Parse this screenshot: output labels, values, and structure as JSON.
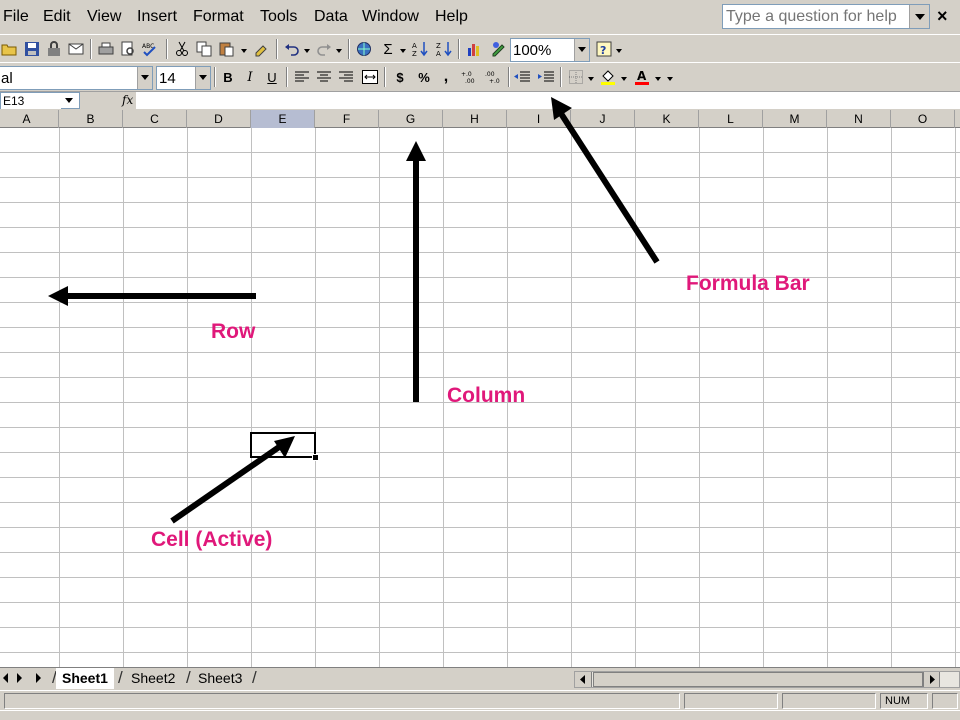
{
  "menubar": {
    "items": [
      {
        "id": "file",
        "label": "File"
      },
      {
        "id": "edit",
        "label": "Edit"
      },
      {
        "id": "view",
        "label": "View"
      },
      {
        "id": "insert",
        "label": "Insert"
      },
      {
        "id": "format",
        "label": "Format"
      },
      {
        "id": "tools",
        "label": "Tools"
      },
      {
        "id": "data",
        "label": "Data"
      },
      {
        "id": "window",
        "label": "Window"
      },
      {
        "id": "help",
        "label": "Help"
      }
    ],
    "help_placeholder": "Type a question for help"
  },
  "standard_toolbar": {
    "zoom": "100%"
  },
  "format_toolbar": {
    "font_name": "al",
    "font_size": "14",
    "bold": "B",
    "italic": "I",
    "underline": "U",
    "currency": "$",
    "percent": "%",
    "comma": ","
  },
  "formula_bar": {
    "name_box": "E13",
    "fx": "fx",
    "formula": ""
  },
  "grid": {
    "columns": [
      "A",
      "B",
      "C",
      "D",
      "E",
      "F",
      "G",
      "H",
      "I",
      "J",
      "K",
      "L",
      "M",
      "N",
      "O"
    ],
    "active_column": "E"
  },
  "annotations": {
    "row": "Row",
    "column": "Column",
    "formula_bar": "Formula Bar",
    "active_cell": "Cell (Active)",
    "color": "#e0187a"
  },
  "sheets": {
    "tabs": [
      "Sheet1",
      "Sheet2",
      "Sheet3"
    ],
    "active": "Sheet1"
  },
  "status_bar": {
    "num": "NUM"
  }
}
